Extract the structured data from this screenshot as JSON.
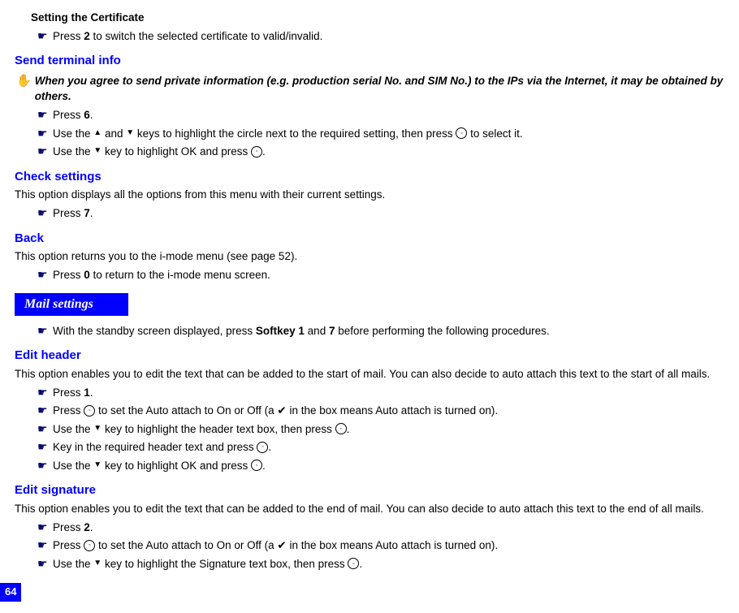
{
  "sec_cert_title": "Setting the Certificate",
  "sec_cert_step1_pre": "Press ",
  "sec_cert_step1_key": "2",
  "sec_cert_step1_post": " to switch the selected certificate to valid/invalid.",
  "send_term_title": "Send terminal info",
  "send_term_note": "When you agree to send private information (e.g. production serial No. and SIM No.) to the IPs via the Internet, it may be obtained by others.",
  "send_term_s1_pre": "Press ",
  "send_term_s1_key": "6",
  "send_term_s1_post": ".",
  "send_term_s2_a": "Use the ",
  "send_term_s2_b": " and ",
  "send_term_s2_c": " keys to highlight the circle next to the required setting, then press ",
  "send_term_s2_d": " to select it.",
  "send_term_s3_a": "Use the ",
  "send_term_s3_b": " key to highlight OK and press ",
  "send_term_s3_c": ".",
  "check_title": "Check settings",
  "check_desc": "This option displays all the options from this menu with their current settings.",
  "check_s1_pre": "Press ",
  "check_s1_key": "7",
  "check_s1_post": ".",
  "back_title": "Back",
  "back_desc": "This option returns you to the i-mode menu (see page 52).",
  "back_s1_pre": "Press ",
  "back_s1_key": "0",
  "back_s1_post": " to return to the i-mode menu screen.",
  "mail_ribbon": "Mail settings",
  "mail_intro_a": "With the standby screen displayed, press ",
  "mail_intro_b": "Softkey 1",
  "mail_intro_c": " and ",
  "mail_intro_d": "7",
  "mail_intro_e": " before performing the following procedures.",
  "edit_header_title": "Edit header",
  "edit_header_desc": "This option enables you to edit the text that can be added to the start of mail. You can also decide to auto attach this text to the start of all mails.",
  "eh_s1_pre": "Press ",
  "eh_s1_key": "1",
  "eh_s1_post": ".",
  "eh_s2_a": "Press ",
  "eh_s2_b": " to set the Auto attach to On or Off (a ",
  "eh_s2_c": " in the box means Auto attach is turned on).",
  "eh_s3_a": "Use the ",
  "eh_s3_b": " key to highlight the header text box, then press ",
  "eh_s3_c": ".",
  "eh_s4_a": "Key in the required header text and press ",
  "eh_s4_b": ".",
  "eh_s5_a": "Use the ",
  "eh_s5_b": " key to highlight OK and press ",
  "eh_s5_c": ".",
  "edit_sig_title": "Edit signature",
  "edit_sig_desc": "This option enables you to edit the text that can be added to the end of mail. You can also decide to auto attach this text to the end of all mails.",
  "es_s1_pre": "Press ",
  "es_s1_key": "2",
  "es_s1_post": ".",
  "es_s2_a": "Press ",
  "es_s2_b": " to set the Auto attach to On or Off (a ",
  "es_s2_c": " in the box means Auto attach is turned on).",
  "es_s3_a": "Use the ",
  "es_s3_b": " key to highlight the Signature text box, then press ",
  "es_s3_c": ".",
  "page_num": "64"
}
